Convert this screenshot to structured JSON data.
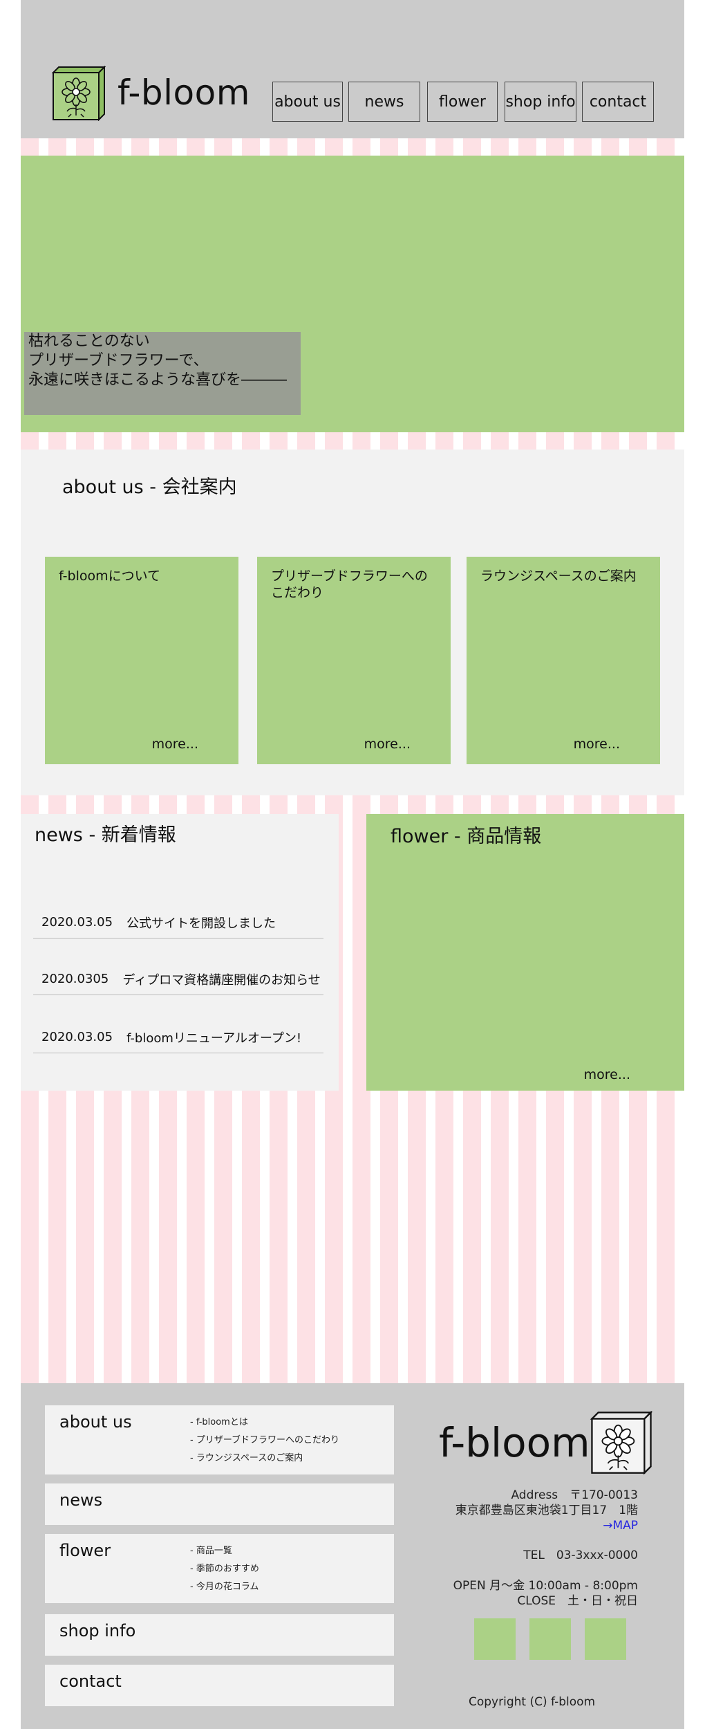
{
  "header": {
    "logo_text": "f-bloom",
    "nav": [
      {
        "label": "about us"
      },
      {
        "label": "news"
      },
      {
        "label": "flower"
      },
      {
        "label": "shop info"
      },
      {
        "label": "contact"
      }
    ]
  },
  "hero": {
    "caption_lines": [
      "枯れることのない",
      "プリザーブドフラワーで、",
      "永遠に咲きほこるような喜びを―――"
    ]
  },
  "about": {
    "heading": "about us - 会社案内",
    "cards": [
      {
        "title": "f-bloomについて",
        "more": "more..."
      },
      {
        "title": "プリザーブドフラワーへのこだわり",
        "more": "more..."
      },
      {
        "title": "ラウンジスペースのご案内",
        "more": "more..."
      }
    ]
  },
  "news": {
    "heading": "news - 新着情報",
    "items": [
      {
        "date": "2020.03.05",
        "title": "公式サイトを開設しました"
      },
      {
        "date": "2020.0305",
        "title": "ディプロマ資格講座開催のお知らせ"
      },
      {
        "date": "2020.03.05",
        "title": "f-bloomリニューアルオープン!"
      }
    ]
  },
  "flower": {
    "heading": "flower - 商品情報",
    "more": "more..."
  },
  "footer": {
    "nav": [
      {
        "title": "about us",
        "subs": [
          "- f-bloomとは",
          "- プリザーブドフラワーへのこだわり",
          "- ラウンジスペースのご案内"
        ]
      },
      {
        "title": "news",
        "subs": []
      },
      {
        "title": "flower",
        "subs": [
          "- 商品一覧",
          "- 季節のおすすめ",
          "- 今月の花コラム"
        ]
      },
      {
        "title": "shop info",
        "subs": []
      },
      {
        "title": "contact",
        "subs": []
      }
    ],
    "logo_text": "f-bloom",
    "address_label": "Address　〒170-0013",
    "address": "東京都豊島区東池袋1丁目17　1階",
    "map_link": "→MAP",
    "tel": "TEL　03-3xxx-0000",
    "open": "OPEN  月〜金 10:00am - 8:00pm",
    "close": "CLOSE　土・日・祝日",
    "copyright": "Copyright (C) f-bloom"
  },
  "colors": {
    "header_bg": "#cbcbcb",
    "green": "#abd186",
    "panel_bg": "#f2f2f2",
    "stripe_pink": "#fde1e5",
    "caption_bg": "#999e93",
    "link": "#2727e0"
  }
}
